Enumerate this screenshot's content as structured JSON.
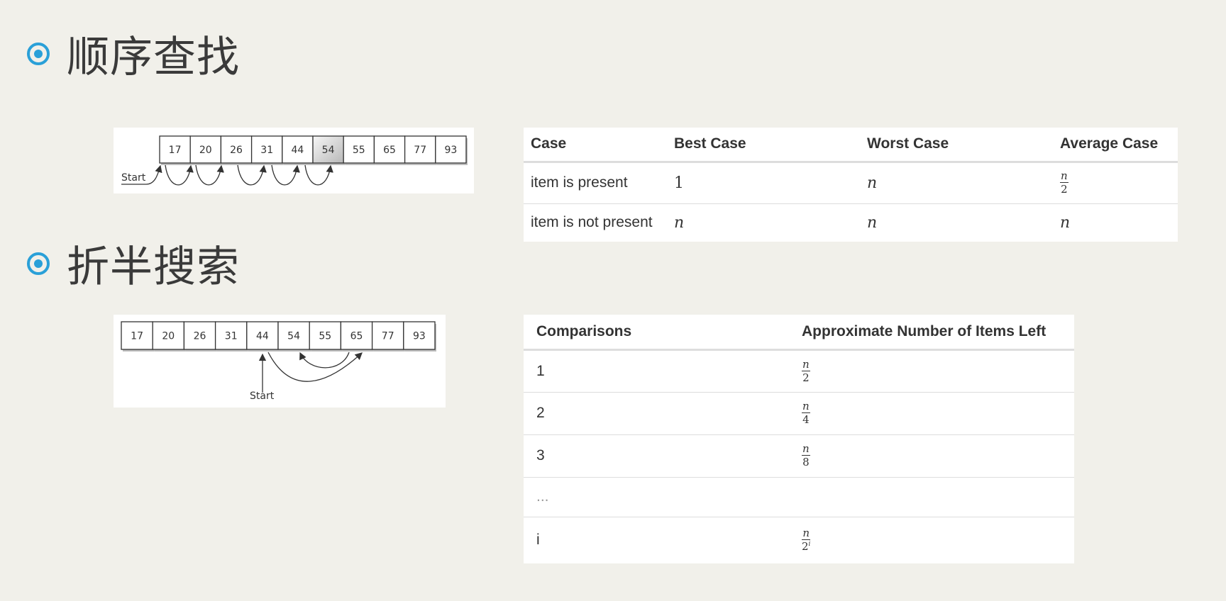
{
  "sections": {
    "sequential": {
      "title": "顺序查找"
    },
    "binary": {
      "title": "折半搜索"
    }
  },
  "sequential_diagram": {
    "values": [
      "17",
      "20",
      "26",
      "31",
      "44",
      "54",
      "55",
      "65",
      "77",
      "93"
    ],
    "start_label": "Start"
  },
  "binary_diagram": {
    "values": [
      "17",
      "20",
      "26",
      "31",
      "44",
      "54",
      "55",
      "65",
      "77",
      "93"
    ],
    "start_label": "Start"
  },
  "sequential_table": {
    "headers": [
      "Case",
      "Best Case",
      "Worst Case",
      "Average Case"
    ],
    "rows": [
      {
        "case": "item is present",
        "best": "1",
        "worst": "n",
        "avg_num": "n",
        "avg_den": "2"
      },
      {
        "case": "item is not present",
        "best": "n",
        "worst": "n",
        "avg": "n"
      }
    ]
  },
  "binary_table": {
    "headers": [
      "Comparisons",
      "Approximate Number of Items Left"
    ],
    "rows": [
      {
        "comparisons": "1",
        "num": "n",
        "den": "2"
      },
      {
        "comparisons": "2",
        "num": "n",
        "den": "4"
      },
      {
        "comparisons": "3",
        "num": "n",
        "den": "8"
      },
      {
        "comparisons": "..."
      },
      {
        "comparisons": "i",
        "num": "n",
        "den": "2",
        "den_exp": "i"
      }
    ]
  }
}
